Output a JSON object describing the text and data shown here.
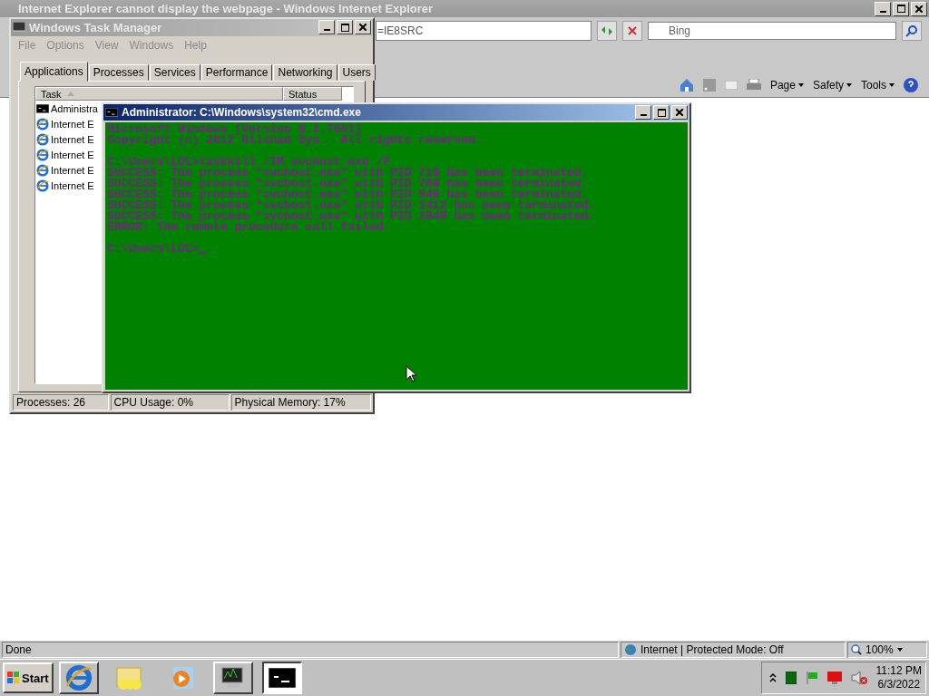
{
  "ie": {
    "title": "Internet Explorer cannot display the webpage - Windows Internet Explorer",
    "address": "=IE8SRC",
    "search": {
      "placeholder": "Bing"
    },
    "command_bar": [
      "Page",
      "Safety",
      "Tools"
    ],
    "status_bar": {
      "text": "Done",
      "zone": "Internet | Protected Mode: Off",
      "zoom": "100%"
    }
  },
  "task_manager": {
    "title": "Windows Task Manager",
    "menu": [
      "File",
      "Options",
      "View",
      "Windows",
      "Help"
    ],
    "tabs": [
      {
        "label": "Applications",
        "selected": true
      },
      {
        "label": "Processes",
        "selected": false
      },
      {
        "label": "Services",
        "selected": false
      },
      {
        "label": "Performance",
        "selected": false
      },
      {
        "label": "Networking",
        "selected": false
      },
      {
        "label": "Users",
        "selected": false
      }
    ],
    "columns": [
      "Task",
      "Status"
    ],
    "tasks": [
      {
        "name": "Administra",
        "kind": "console"
      },
      {
        "name": "Internet E",
        "kind": "browser"
      },
      {
        "name": "Internet E",
        "kind": "browser"
      },
      {
        "name": "Internet E",
        "kind": "browser"
      },
      {
        "name": "Internet E",
        "kind": "browser"
      },
      {
        "name": "Internet E",
        "kind": "browser"
      }
    ],
    "status_bar": [
      "Processes: 26",
      "CPU Usage: 0%",
      "Physical Memory: 17%"
    ]
  },
  "console": {
    "title": "Administrator: C:\\Windows\\system32\\cmd.exe",
    "blocks": [
      [
        "Microsoft Windows [Version 6.1.7601]",
        "Copyright (c) 2012 Dilshad Sys.  All rights reserved."
      ],
      [
        "C:\\Users\\LOL>taskkill /IM svchost.exe /F",
        "SUCCESS: The process \"svchost.exe\" with PID 716 has been terminated.",
        "SUCCESS: The process \"svchost.exe\" with PID 780 has been terminated.",
        "SUCCESS: The process \"svchost.exe\" with PID 940 has been terminated.",
        "SUCCESS: The process \"svchost.exe\" with PID 1412 has been terminated.",
        "SUCCESS: The process \"svchost.exe\" with PID 1940 has been terminated.",
        "ERROR: The remote procedure call failed."
      ],
      [
        "C:\\Users\\LOL>"
      ]
    ]
  },
  "taskbar": {
    "start": "Start",
    "apps": [
      {
        "kind": "browser",
        "running": true,
        "selected": false
      },
      {
        "kind": "folder",
        "running": false,
        "selected": false
      },
      {
        "kind": "media",
        "running": false,
        "selected": false
      },
      {
        "kind": "monitor",
        "running": true,
        "selected": false
      },
      {
        "kind": "console",
        "running": true,
        "selected": true
      }
    ],
    "clock": {
      "time": "11:12 PM",
      "date": "6/3/2022"
    }
  }
}
